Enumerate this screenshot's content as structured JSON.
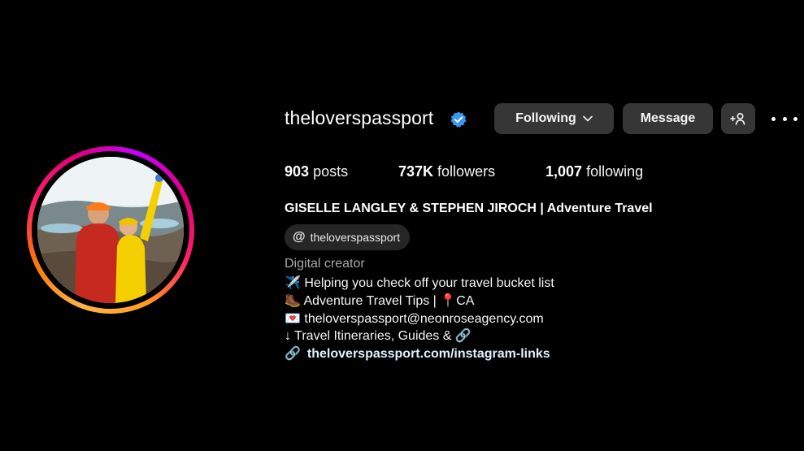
{
  "profile": {
    "username": "theloverspassport",
    "verified": true,
    "avatar_alt": "profile-photo"
  },
  "actions": {
    "following_label": "Following",
    "following_chevron": "⌄",
    "message_label": "Message",
    "add_user_icon": "+👤",
    "more_icon": "more-horizontal-icon"
  },
  "stats": {
    "posts_count": "903",
    "posts_label": "posts",
    "followers_count": "737K",
    "followers_label": "followers",
    "following_count": "1,007",
    "following_label": "following"
  },
  "bio": {
    "full_name": "GISELLE LANGLEY & STEPHEN JIROCH | Adventure Travel",
    "threads_handle": "theloverspassport",
    "threads_icon": "@",
    "category": "Digital creator",
    "line1": "✈️ Helping you check off your travel bucket list",
    "line2": "🥾 Adventure Travel Tips | 📍CA",
    "line3": "💌 theloverspassport@neonroseagency.com",
    "line4": "↓ Travel Itineraries, Guides & 🔗",
    "link_icon": "🔗",
    "link_text": "theloverspassport.com/instagram-links"
  },
  "colors": {
    "background": "#000000",
    "button_bg": "#363636",
    "verified_blue": "#3897f0",
    "secondary_text": "#a8a8a8",
    "story_ring": [
      "#ffb347",
      "#ff1f6b",
      "#c400ff"
    ]
  }
}
